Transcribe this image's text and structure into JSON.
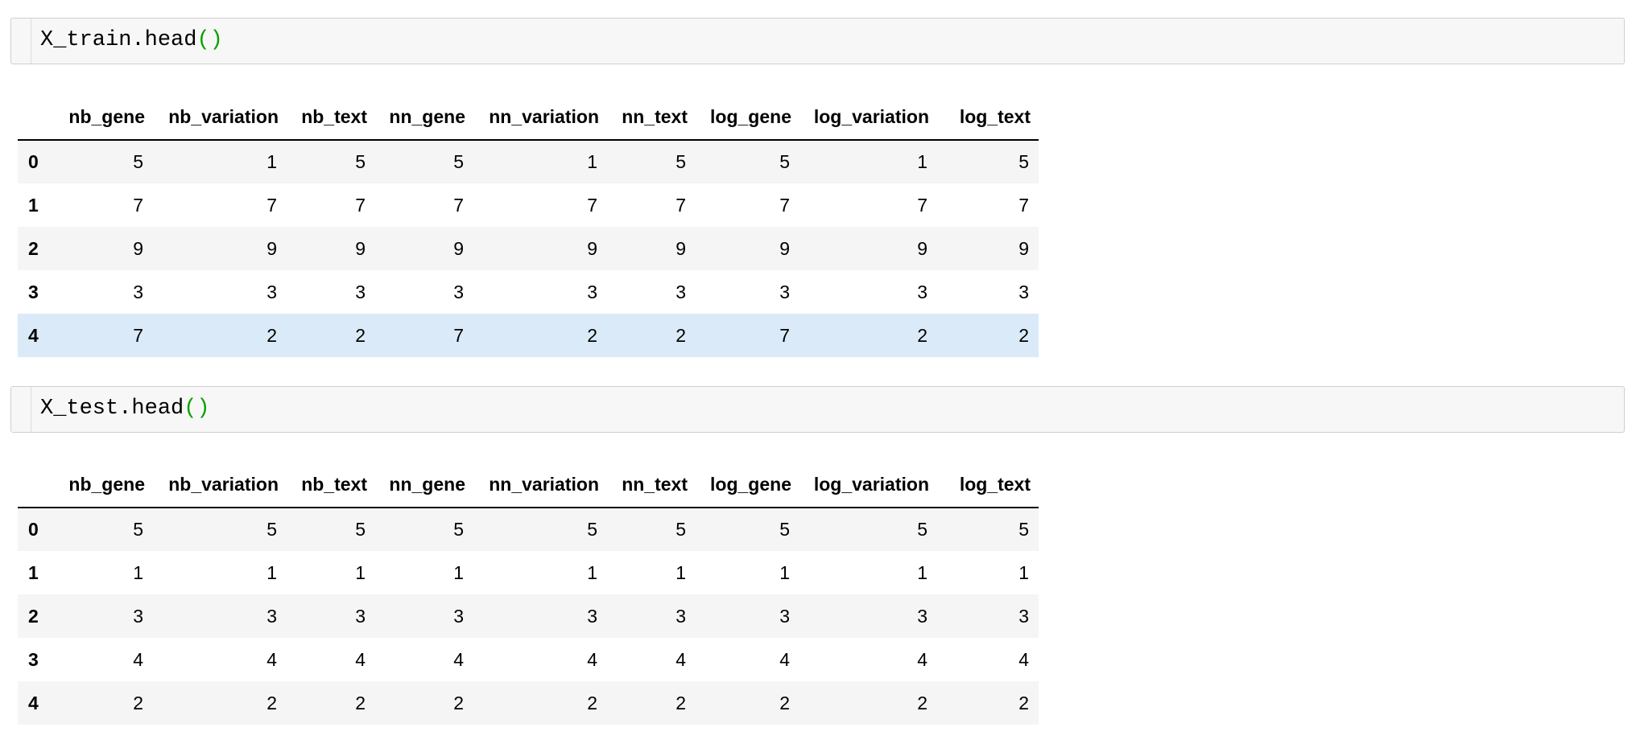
{
  "cells": [
    {
      "code_name": "X_train.head",
      "code_parens": "()",
      "columns": [
        "nb_gene",
        "nb_variation",
        "nb_text",
        "nn_gene",
        "nn_variation",
        "nn_text",
        "log_gene",
        "log_variation",
        "log_text"
      ],
      "index": [
        "0",
        "1",
        "2",
        "3",
        "4"
      ],
      "rows": [
        [
          "5",
          "1",
          "5",
          "5",
          "1",
          "5",
          "5",
          "1",
          "5"
        ],
        [
          "7",
          "7",
          "7",
          "7",
          "7",
          "7",
          "7",
          "7",
          "7"
        ],
        [
          "9",
          "9",
          "9",
          "9",
          "9",
          "9",
          "9",
          "9",
          "9"
        ],
        [
          "3",
          "3",
          "3",
          "3",
          "3",
          "3",
          "3",
          "3",
          "3"
        ],
        [
          "7",
          "2",
          "2",
          "7",
          "2",
          "2",
          "7",
          "2",
          "2"
        ]
      ],
      "highlighted_row": 4
    },
    {
      "code_name": "X_test.head",
      "code_parens": "()",
      "columns": [
        "nb_gene",
        "nb_variation",
        "nb_text",
        "nn_gene",
        "nn_variation",
        "nn_text",
        "log_gene",
        "log_variation",
        "log_text"
      ],
      "index": [
        "0",
        "1",
        "2",
        "3",
        "4"
      ],
      "rows": [
        [
          "5",
          "5",
          "5",
          "5",
          "5",
          "5",
          "5",
          "5",
          "5"
        ],
        [
          "1",
          "1",
          "1",
          "1",
          "1",
          "1",
          "1",
          "1",
          "1"
        ],
        [
          "3",
          "3",
          "3",
          "3",
          "3",
          "3",
          "3",
          "3",
          "3"
        ],
        [
          "4",
          "4",
          "4",
          "4",
          "4",
          "4",
          "4",
          "4",
          "4"
        ],
        [
          "2",
          "2",
          "2",
          "2",
          "2",
          "2",
          "2",
          "2",
          "2"
        ]
      ],
      "highlighted_row": null
    }
  ],
  "colors": {
    "code_paren": "#0aa000",
    "row_stripe": "#f5f5f5",
    "row_hover": "#daeaf8",
    "input_bg": "#f7f7f7"
  }
}
